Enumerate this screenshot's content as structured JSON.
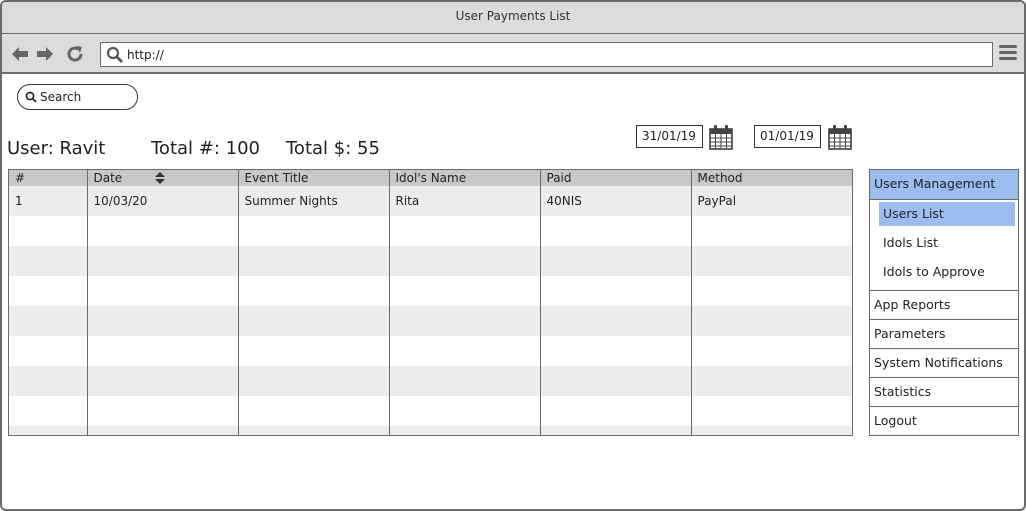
{
  "window": {
    "title": "User Payments List"
  },
  "browser": {
    "url": "http://",
    "icons": [
      "back-arrow-icon",
      "forward-arrow-icon",
      "reload-icon",
      "search-icon",
      "hamburger-menu-icon"
    ]
  },
  "search": {
    "placeholder": "Search"
  },
  "summary": {
    "user": "User: Ravit",
    "total_count": "Total #: 100",
    "total_amount": "Total $: 55"
  },
  "date_range": {
    "from": "31/01/19",
    "to": "01/01/19"
  },
  "table": {
    "columns": [
      "#",
      "Date",
      "Event Title",
      "Idol's Name",
      "Paid",
      "Method"
    ],
    "sortable_column": "Date",
    "rows": [
      [
        "1",
        "10/03/20",
        "Summer Nights",
        "Rita",
        "40NIS",
        "PayPal"
      ],
      [
        "",
        "",
        "",
        "",
        "",
        ""
      ],
      [
        "",
        "",
        "",
        "",
        "",
        ""
      ],
      [
        "",
        "",
        "",
        "",
        "",
        ""
      ],
      [
        "",
        "",
        "",
        "",
        "",
        ""
      ],
      [
        "",
        "",
        "",
        "",
        "",
        ""
      ],
      [
        "",
        "",
        "",
        "",
        "",
        ""
      ],
      [
        "",
        "",
        "",
        "",
        "",
        ""
      ],
      [
        "",
        "",
        "",
        "",
        "",
        ""
      ]
    ]
  },
  "menu": {
    "section": "Users Management",
    "subitems": [
      {
        "label": "Users List",
        "active": true
      },
      {
        "label": "Idols List",
        "active": false
      },
      {
        "label": "Idols to Approve",
        "active": false
      }
    ],
    "items": [
      "App Reports",
      "Parameters",
      "System Notifications",
      "Statistics",
      "Logout"
    ]
  },
  "colors": {
    "accent": "#9bbdf0",
    "chrome": "#dcdcdc",
    "header_row": "#c8c8c8",
    "stripe": "#ececec",
    "border": "#6a6a6a"
  }
}
